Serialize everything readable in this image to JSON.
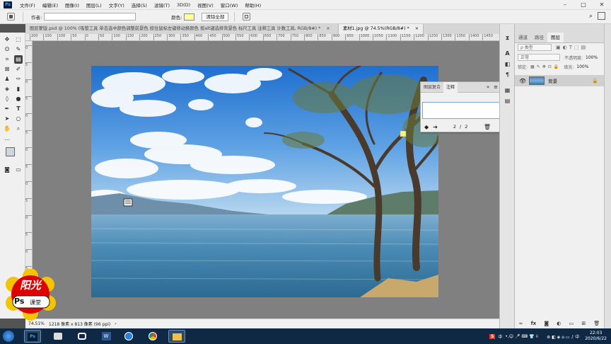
{
  "app": {
    "logo": "Ps"
  },
  "menu": [
    "文件(F)",
    "编辑(E)",
    "图像(I)",
    "图层(L)",
    "文字(Y)",
    "选择(S)",
    "滤镜(T)",
    "3D(D)",
    "视图(V)",
    "窗口(W)",
    "帮助(H)"
  ],
  "options": {
    "author_label": "作者:",
    "author_value": "",
    "color_label": "颜色:",
    "color_value": "#ffff99",
    "clear_all": "清除全部"
  },
  "tabs": [
    {
      "label": "图层蒙版.psd @ 100% (吸管工具 单击选中颜色调整前景色 按住鼠标左键移动换颜色 按alt键选择背景色 标尺工具 注释工具 计数工具, RGB/8#) *",
      "close": "×"
    },
    {
      "label": "素材1.jpg @ 74.5%(RGB/8#) *",
      "close": "×"
    }
  ],
  "ruler_h": [
    "200",
    "150",
    "100",
    "50",
    "0",
    "50",
    "100",
    "150",
    "200",
    "250",
    "300",
    "350",
    "400",
    "450",
    "500",
    "550",
    "600",
    "650",
    "700",
    "750",
    "800",
    "850",
    "900",
    "950",
    "1000",
    "1050",
    "1100",
    "1150",
    "1200",
    "1250",
    "1300",
    "1350",
    "1400",
    "1450"
  ],
  "ruler_v": [
    "0",
    "5",
    "0",
    "5",
    "0",
    "5",
    "0",
    "5",
    "0",
    "5",
    "0",
    "5",
    "0",
    "5",
    "0",
    "5"
  ],
  "notes_panel": {
    "tabs": [
      "图层复合",
      "注释"
    ],
    "collapse": "»",
    "menu": "≡",
    "page_current": "2",
    "page_sep": "/",
    "page_total": "2"
  },
  "status": {
    "zoom": "74.51%",
    "doc_info": "1218 像素 x 813 像素 (96 ppi)",
    "arrow": "›"
  },
  "layers_panel": {
    "tabs": [
      "通道",
      "路径",
      "图层"
    ],
    "filter_label": "ρ 类型",
    "blend_mode": "正常",
    "opacity_label": "不透明度:",
    "opacity_value": "100%",
    "lock_label": "锁定:",
    "fill_label": "填充:",
    "fill_value": "100%",
    "layer_name": "背景"
  },
  "badge": {
    "name": "阳光",
    "ps": "Ps",
    "sub": "课堂"
  },
  "taskbar": {
    "time": "22:03",
    "date": "2020/6/22",
    "ime": "中"
  }
}
